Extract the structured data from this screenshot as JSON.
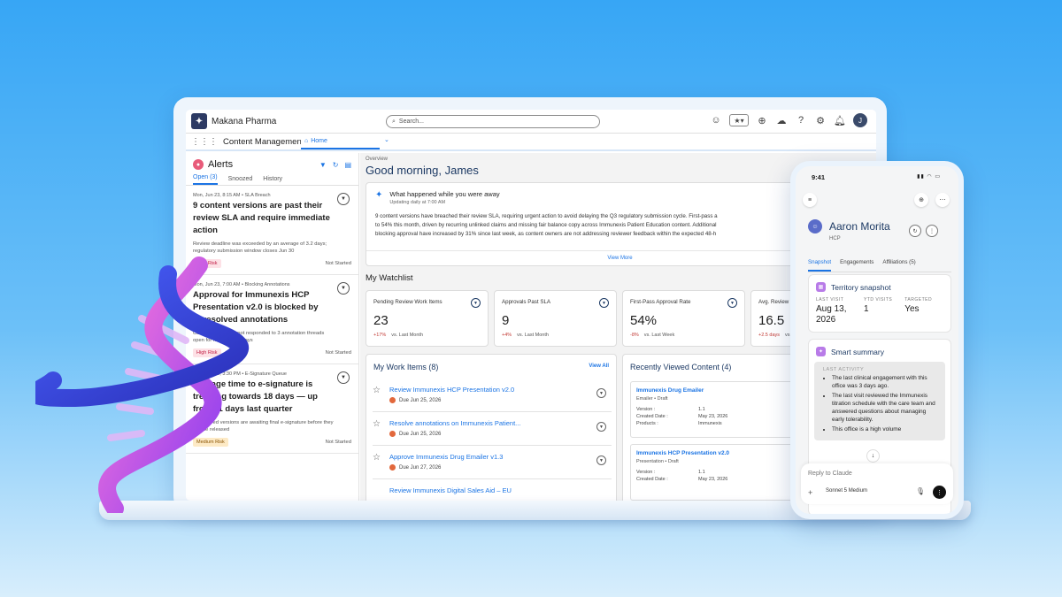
{
  "topbar": {
    "brand": "Makana Pharma",
    "search_placeholder": "Search..."
  },
  "nav": {
    "app_title": "Content Management",
    "home_tab": "Home"
  },
  "alerts": {
    "title": "Alerts",
    "tabs": [
      "Open (3)",
      "Snoozed",
      "History"
    ],
    "items": [
      {
        "meta": "Mon, Jun 23, 8:15 AM • SLA Breach",
        "title": "9 content versions are past their review SLA and require immediate action",
        "desc": "Review deadline was exceeded by an average of 3.2 days; regulatory submission window closes Jun 30",
        "badge": "High Risk",
        "status": "Not Started"
      },
      {
        "meta": "Mon, Jun 23, 7:00 AM • Blocking Annotations",
        "title": "Approval for Immunexis HCP Presentation v2.0 is blocked by unresolved annotations",
        "desc": "Content owner has not responded to 3 annotation threads open for more than 5 days",
        "badge": "High Risk",
        "status": "Not Started"
      },
      {
        "meta": "Mon, Jun 19, 3:30 PM • E-Signature Queue",
        "title": "Average time to e-signature is trending towards 18 days — up from 11 days last quarter",
        "desc": "4 approved versions are awaiting final e-signature before they can be released",
        "badge": "Medium Risk",
        "status": "Not Started"
      }
    ]
  },
  "main": {
    "overview_label": "Overview",
    "greeting": "Good morning, James",
    "happened": {
      "title": "What happened while you were away",
      "subtitle": "Updating daily at 7:00 AM",
      "lines": [
        "9 content versions have breached their review SLA, requiring urgent action to avoid delaying the Q3 regulatory submission cycle. First-pass a",
        "to 54% this month, driven by recurring unlinked claims and missing fair balance copy across Immunexis Patient Education content. Additional",
        "blocking approval have increased by 31% since last week, as content owners are not addressing reviewer feedback within the expected 48-h"
      ],
      "view_more": "View More"
    },
    "watchlist_title": "My Watchlist",
    "kpis": [
      {
        "label": "Pending Review Work Items",
        "value": "23",
        "delta": "+17%",
        "compare": "vs. Last Month"
      },
      {
        "label": "Approvals Past SLA",
        "value": "9",
        "delta": "+4%",
        "compare": "vs. Last Month"
      },
      {
        "label": "First-Pass Approval Rate",
        "value": "54%",
        "delta": "-8%",
        "compare": "vs. Last Week"
      },
      {
        "label": "Avg. Review",
        "value": "16.5",
        "delta": "+2.5 days",
        "compare": "vs."
      }
    ],
    "work": {
      "title": "My Work Items (8)",
      "view_all": "View All",
      "items": [
        {
          "title": "Review Immunexis HCP Presentation v2.0",
          "due": "Due Jun 25, 2026"
        },
        {
          "title": "Resolve annotations on Immunexis Patient...",
          "due": "Due Jun 25, 2026"
        },
        {
          "title": "Approve Immunexis Drug Emailer v1.3",
          "due": "Due Jun 27, 2026"
        },
        {
          "title": "Review Immunexis Digital Sales Aid – EU",
          "due": ""
        }
      ]
    },
    "recent": {
      "title": "Recently Viewed Content (4)",
      "items": [
        {
          "title": "Immunexis Drug Emailer",
          "type": "Emailer",
          "state": "Draft",
          "version": "1.1",
          "created": "May 23, 2026",
          "products": "Immunexis"
        },
        {
          "title": "Immunexis HCP Presentation v2.0",
          "type": "Presentation",
          "state": "Draft",
          "version": "1.1",
          "created": "May 23, 2026",
          "products": ""
        }
      ],
      "labels": {
        "version": "Version :",
        "created": "Created Date :",
        "products": "Products :"
      }
    }
  },
  "phone": {
    "time": "9:41",
    "name": "Aaron Morita",
    "role": "HCP",
    "tabs": [
      "Snapshot",
      "Engagements",
      "Affiliations (5)"
    ],
    "territory": {
      "title": "Territory snapshot",
      "cols": [
        {
          "h": "LAST VISIT",
          "v": "Aug 13, 2026"
        },
        {
          "h": "YTD VISITS",
          "v": "1"
        },
        {
          "h": "TARGETED",
          "v": "Yes"
        }
      ]
    },
    "summary": {
      "title": "Smart summary",
      "last_activity": "LAST ACTIVITY",
      "bullets": [
        "The last clinical engagement with this office was 3 days ago.",
        "The last visit reviewed the Immunexis titration schedule with the care team and answered questions about managing early tolerability.",
        "This office is a high volume"
      ]
    },
    "reply_placeholder": "Reply to Claude",
    "model": "Sonnet 5 Medium"
  }
}
